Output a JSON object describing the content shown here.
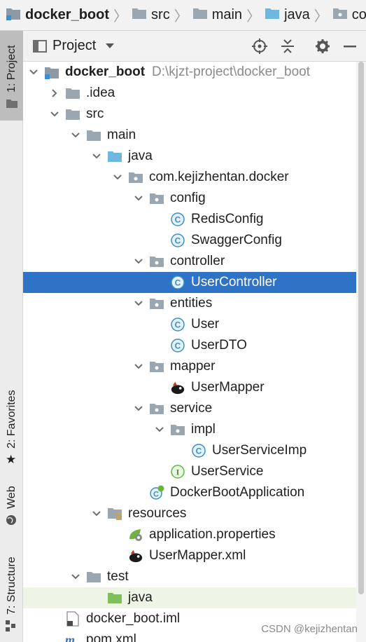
{
  "breadcrumb": [
    {
      "label": "docker_boot",
      "icon": "module-folder-icon"
    },
    {
      "label": "src",
      "icon": "folder-icon"
    },
    {
      "label": "main",
      "icon": "folder-icon"
    },
    {
      "label": "java",
      "icon": "source-folder-icon"
    },
    {
      "label": "com",
      "icon": "package-icon"
    }
  ],
  "toolstrip": {
    "project": "1: Project",
    "favorites": "2: Favorites",
    "web": "Web",
    "structure": "7: Structure"
  },
  "panel": {
    "title": "Project"
  },
  "tree": [
    {
      "label": "docker_boot",
      "path": "D:\\kjzt-project\\docker_boot",
      "depth": 0,
      "arrow": "down",
      "icon": "module",
      "bold": true
    },
    {
      "label": ".idea",
      "depth": 1,
      "arrow": "right",
      "icon": "folder"
    },
    {
      "label": "src",
      "depth": 1,
      "arrow": "down",
      "icon": "folder"
    },
    {
      "label": "main",
      "depth": 2,
      "arrow": "down",
      "icon": "folder"
    },
    {
      "label": "java",
      "depth": 3,
      "arrow": "down",
      "icon": "source-folder"
    },
    {
      "label": "com.kejizhentan.docker",
      "depth": 4,
      "arrow": "down",
      "icon": "package"
    },
    {
      "label": "config",
      "depth": 5,
      "arrow": "down",
      "icon": "package"
    },
    {
      "label": "RedisConfig",
      "depth": 6,
      "arrow": "none",
      "icon": "class"
    },
    {
      "label": "SwaggerConfig",
      "depth": 6,
      "arrow": "none",
      "icon": "class"
    },
    {
      "label": "controller",
      "depth": 5,
      "arrow": "down",
      "icon": "package"
    },
    {
      "label": "UserController",
      "depth": 6,
      "arrow": "none",
      "icon": "class",
      "selected": true
    },
    {
      "label": "entities",
      "depth": 5,
      "arrow": "down",
      "icon": "package"
    },
    {
      "label": "User",
      "depth": 6,
      "arrow": "none",
      "icon": "class"
    },
    {
      "label": "UserDTO",
      "depth": 6,
      "arrow": "none",
      "icon": "class"
    },
    {
      "label": "mapper",
      "depth": 5,
      "arrow": "down",
      "icon": "package"
    },
    {
      "label": "UserMapper",
      "depth": 6,
      "arrow": "none",
      "icon": "mybatis"
    },
    {
      "label": "service",
      "depth": 5,
      "arrow": "down",
      "icon": "package"
    },
    {
      "label": "impl",
      "depth": 6,
      "arrow": "down",
      "icon": "package"
    },
    {
      "label": "UserServiceImp",
      "depth": 7,
      "arrow": "none",
      "icon": "class"
    },
    {
      "label": "UserService",
      "depth": 6,
      "arrow": "none",
      "icon": "interface"
    },
    {
      "label": "DockerBootApplication",
      "depth": 5,
      "arrow": "none",
      "icon": "spring-class"
    },
    {
      "label": "resources",
      "depth": 3,
      "arrow": "down",
      "icon": "resources-folder"
    },
    {
      "label": "application.properties",
      "depth": 4,
      "arrow": "none",
      "icon": "spring-properties"
    },
    {
      "label": "UserMapper.xml",
      "depth": 4,
      "arrow": "none",
      "icon": "mybatis"
    },
    {
      "label": "test",
      "depth": 2,
      "arrow": "down",
      "icon": "folder"
    },
    {
      "label": "java",
      "depth": 3,
      "arrow": "none",
      "icon": "test-folder",
      "highlight": true
    },
    {
      "label": "docker_boot.iml",
      "depth": 1,
      "arrow": "none",
      "icon": "iml-file"
    },
    {
      "label": "pom.xml",
      "depth": 1,
      "arrow": "none",
      "icon": "maven-file"
    }
  ],
  "watermark": "CSDN @kejizhentan",
  "colors": {
    "selection": "#2e73c6",
    "class_icon": "#3d8fc5",
    "interface_icon": "#62b543",
    "folder": "#9aa7b0",
    "source_folder": "#6fb7e0",
    "test_folder": "#7fbf5c"
  }
}
